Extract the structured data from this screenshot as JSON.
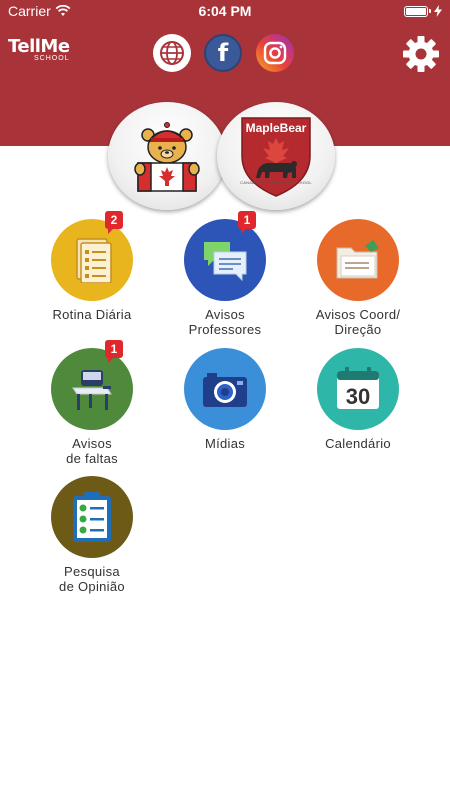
{
  "status_bar": {
    "carrier": "Carrier",
    "time": "6:04 PM",
    "battery_level": 1.0
  },
  "header": {
    "logo_text": "TellMe",
    "logo_sub": "SCHOOL",
    "background_color": "#a8343a",
    "social": [
      {
        "name": "globe-icon"
      },
      {
        "name": "facebook-icon",
        "glyph": "f"
      },
      {
        "name": "instagram-icon"
      }
    ],
    "settings_icon": "gear-icon"
  },
  "brands": {
    "bear_logo": "canada-bear-logo",
    "maple_bear": {
      "title": "MapleBear",
      "subtitle": "CANADIAN ELEMENTARY SCHOOL"
    }
  },
  "menu": [
    {
      "label": "Rotina Diária",
      "badge": "2",
      "color": "#e8b51f",
      "icon": "checklist-icon"
    },
    {
      "label": "Avisos\nProfessores",
      "badge": "1",
      "color": "#2d55b8",
      "icon": "chat-icon"
    },
    {
      "label": "Avisos Coord/\nDireção",
      "badge": "",
      "color": "#e86a2a",
      "icon": "folder-icon"
    },
    {
      "label": "Avisos\nde faltas",
      "badge": "1",
      "color": "#4f8a3c",
      "icon": "desk-icon"
    },
    {
      "label": "Mídias",
      "badge": "",
      "color": "#3a8fd8",
      "icon": "camera-icon"
    },
    {
      "label": "Calendário",
      "badge": "",
      "color": "#2eb6a8",
      "icon": "calendar-icon",
      "day": "30"
    },
    {
      "label": "Pesquisa\nde Opinião",
      "badge": "",
      "color": "#6e5a17",
      "icon": "clipboard-icon"
    }
  ]
}
